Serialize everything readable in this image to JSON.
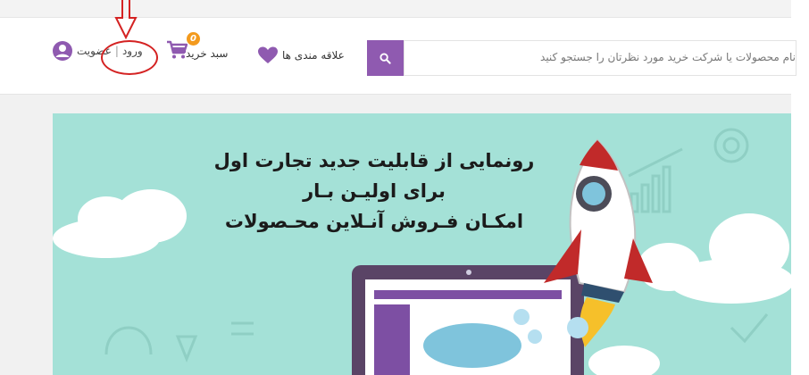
{
  "header": {
    "search_placeholder": "نام محصولات یا شرکت خرید مورد نظرتان را جستجو کنید",
    "search_button_icon": "search-icon",
    "wishlist_label": "علاقه مندی ها",
    "cart_label": "سبد خرید",
    "cart_count": "0",
    "login_label": "ورود",
    "separator": "|",
    "register_label": "عضویت",
    "accent_color": "#8f5ab0",
    "badge_color": "#f39a1d"
  },
  "banner": {
    "line1": "رونمایی از قابلیت جدید تجارت اول",
    "line2": "برای اولیـن بـار",
    "line3": "امکـان فـروش آنـلاین محـصولات",
    "background_color": "#a4e1d7"
  },
  "annotation": {
    "arrow_icon": "down-arrow-annotation",
    "ellipse_color": "#d42222"
  }
}
